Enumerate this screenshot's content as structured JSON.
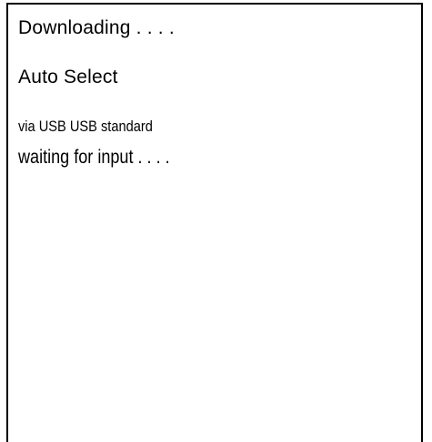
{
  "display": {
    "status_text": "Downloading . . . .",
    "mode_text": "Auto Select",
    "port_text": "via USB USB standard",
    "prompt_text": "waiting for input . . . ."
  }
}
